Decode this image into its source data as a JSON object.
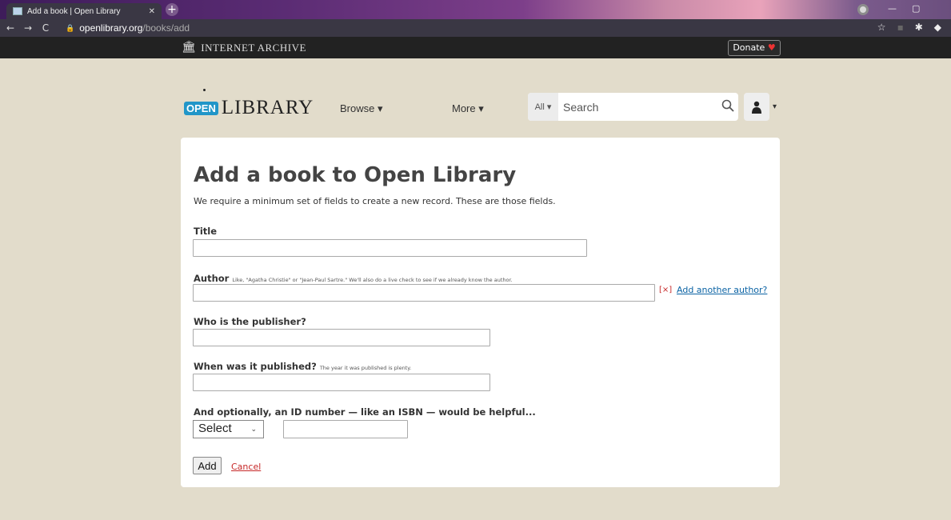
{
  "browser": {
    "tab_title": "Add a book | Open Library",
    "url_host": "openlibrary.org",
    "url_path": "/books/add"
  },
  "ia_bar": {
    "logo_text": "INTERNET ARCHIVE",
    "donate_label": "Donate"
  },
  "header": {
    "logo_open": "OPEN",
    "logo_library": "LIBRARY",
    "browse_label": "Browse ▾",
    "more_label": "More ▾",
    "search_scope": "All ▾",
    "search_placeholder": "Search"
  },
  "form": {
    "title": "Add a book to Open Library",
    "intro": "We require a minimum set of fields to create a new record. These are those fields.",
    "title_label": "Title",
    "author_label": "Author",
    "author_hint": "Like, \"Agatha Christie\" or \"Jean-Paul Sartre.\" We'll also do a live check to see if we already know the author.",
    "remove_author": "[×]",
    "add_author_link": "Add another author?",
    "publisher_label": "Who is the publisher?",
    "published_label": "When was it published?",
    "published_hint": "The year it was published is plenty.",
    "id_label": "And optionally, an ID number — like an ISBN — would be helpful...",
    "id_select_value": "Select",
    "add_button": "Add",
    "cancel_link": "Cancel"
  }
}
